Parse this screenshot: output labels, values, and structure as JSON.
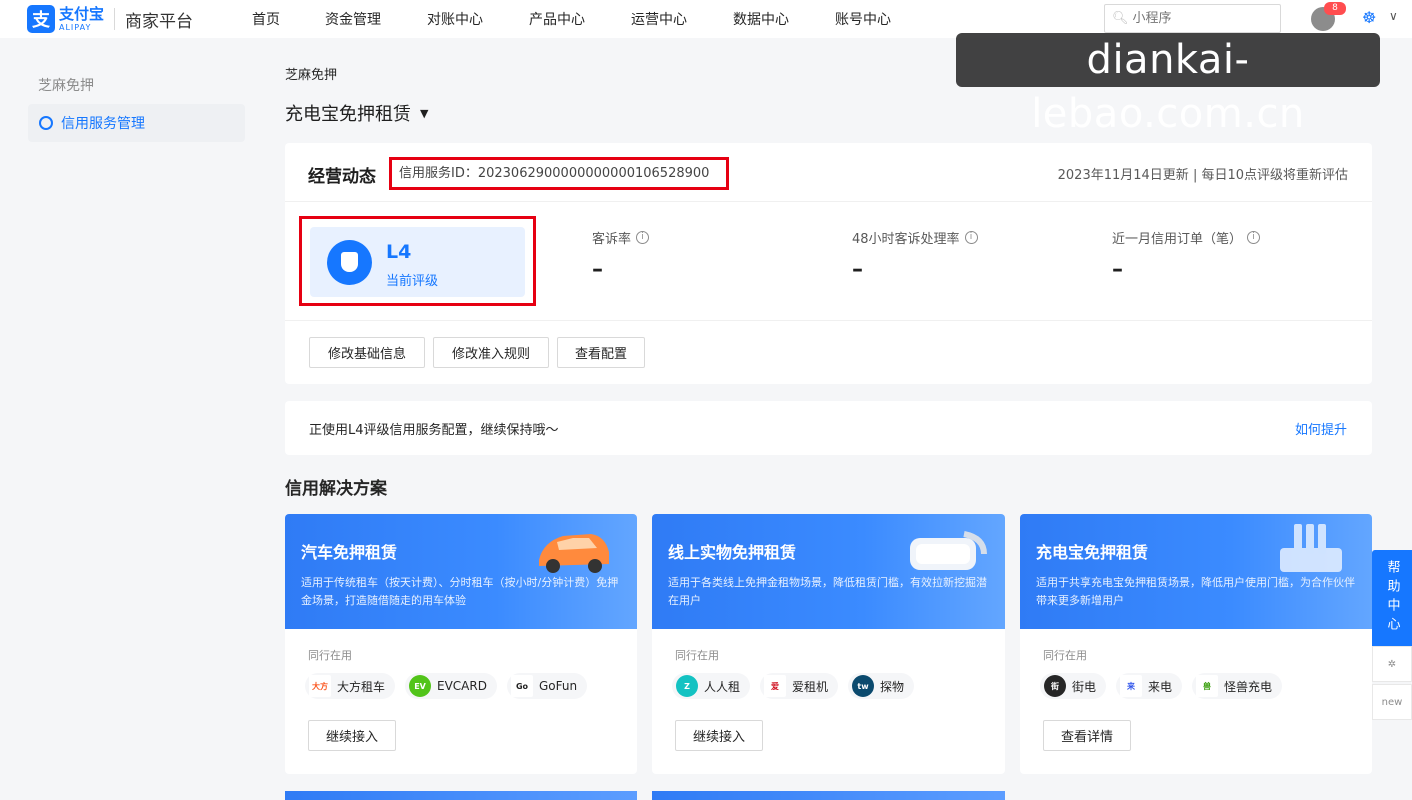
{
  "header": {
    "logo_mark": "支",
    "logo_cn": "支付宝",
    "logo_en": "ALIPAY",
    "platform": "商家平台",
    "nav": [
      "首页",
      "资金管理",
      "对账中心",
      "产品中心",
      "运营中心",
      "数据中心",
      "账号中心"
    ],
    "search_placeholder": "小程序",
    "notification_count": "8"
  },
  "watermark": "diankai-lebao.com.cn",
  "sidebar": {
    "title": "芝麻免押",
    "items": [
      {
        "label": "信用服务管理",
        "active": true
      }
    ]
  },
  "breadcrumb": "芝麻免押",
  "page_title": "充电宝免押租赁",
  "overview": {
    "title": "经营动态",
    "service_id": "信用服务ID：2023062900000000000106528900",
    "update_note": "2023年11月14日更新 | 每日10点评级将重新评估",
    "rating": {
      "level": "L4",
      "label": "当前评级"
    },
    "metrics": [
      {
        "label": "客诉率",
        "value": "–"
      },
      {
        "label": "48小时客诉处理率",
        "value": "–"
      },
      {
        "label": "近一月信用订单（笔）",
        "value": "–"
      }
    ],
    "buttons": [
      "修改基础信息",
      "修改准入规则",
      "查看配置"
    ]
  },
  "banner": {
    "text": "正使用L4评级信用服务配置，继续保持哦～",
    "link": "如何提升"
  },
  "solutions": {
    "title": "信用解决方案",
    "peers_label": "同行在用",
    "cards": [
      {
        "title": "汽车免押租赁",
        "desc": "适用于传统租车（按天计费）、分时租车（按小时/分钟计费）免押金场景，打造随借随走的用车体验",
        "peers": [
          {
            "name": "大方租车",
            "logo": "大方",
            "color": "#e8e8e8"
          },
          {
            "name": "EVCARD",
            "logo": "EV",
            "color": "#52c41a"
          },
          {
            "name": "GoFun",
            "logo": "Go",
            "color": "#e8e8e8"
          }
        ],
        "button": "继续接入"
      },
      {
        "title": "线上实物免押租赁",
        "desc": "适用于各类线上免押金租物场景，降低租赁门槛，有效拉新挖掘潜在用户",
        "peers": [
          {
            "name": "人人租",
            "logo": "Z",
            "color": "#13c2c2"
          },
          {
            "name": "爱租机",
            "logo": "爱",
            "color": "#cf1322"
          },
          {
            "name": "探物",
            "logo": "tw",
            "color": "#0b4a6e"
          }
        ],
        "button": "继续接入"
      },
      {
        "title": "充电宝免押租赁",
        "desc": "适用于共享充电宝免押租赁场景，降低用户使用门槛，为合作伙伴带来更多新增用户",
        "peers": [
          {
            "name": "街电",
            "logo": "街",
            "color": "#262626"
          },
          {
            "name": "来电",
            "logo": "来",
            "color": "#d6e4ff"
          },
          {
            "name": "怪兽充电",
            "logo": "兽",
            "color": "#b7eb8f"
          }
        ],
        "button": "查看详情"
      }
    ]
  },
  "help": {
    "label": "帮助中心",
    "new_label": "new"
  }
}
